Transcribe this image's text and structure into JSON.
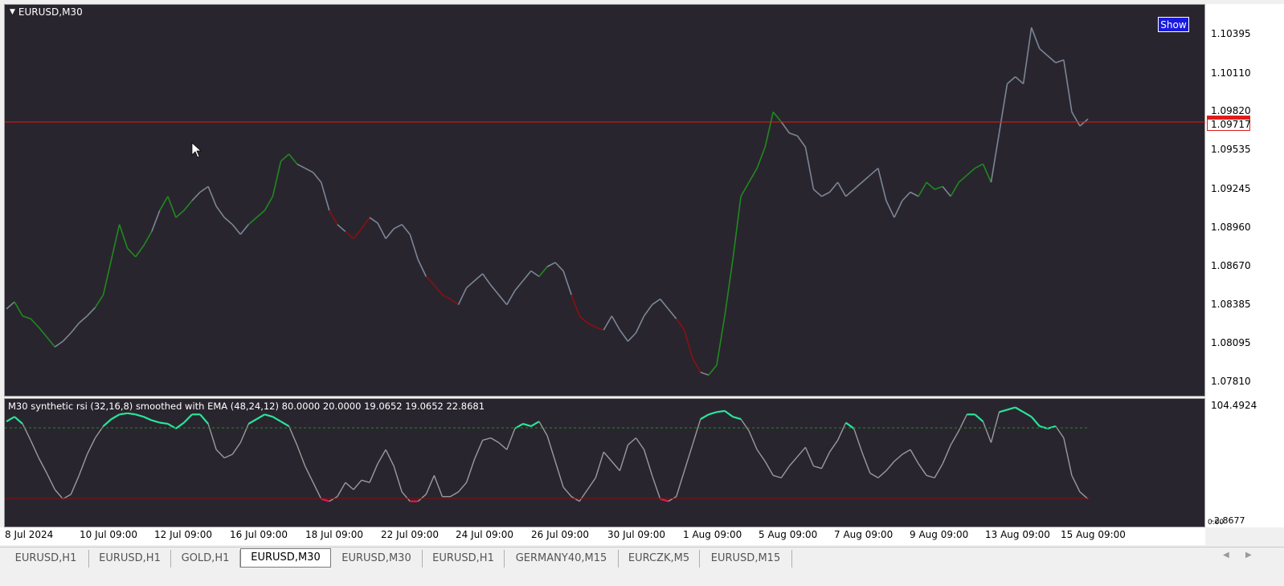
{
  "window": {
    "chart_title": "EURUSD,M30",
    "show_label": "Show"
  },
  "indicator": {
    "title": "M30 synthetic rsi (32,16,8) smoothed with EMA (48,24,12) 80.0000 20.0000 19.0652 19.0652 22.8681",
    "scale_top": "104.4924",
    "scale_bottom": "-2.8677",
    "scale_bottom_overlap": "0.00"
  },
  "price_scale": {
    "labels": [
      "1.10395",
      "1.10110",
      "1.09820",
      "1.09535",
      "1.09245",
      "1.08960",
      "1.08670",
      "1.08385",
      "1.08095",
      "1.07810"
    ],
    "current_price": "1.09717",
    "current_price_color": "#e01b1b"
  },
  "time_axis": {
    "labels": [
      "8 Jul 2024",
      "10 Jul 09:00",
      "12 Jul 09:00",
      "16 Jul 09:00",
      "18 Jul 09:00",
      "22 Jul 09:00",
      "24 Jul 09:00",
      "26 Jul 09:00",
      "30 Jul 09:00",
      "1 Aug 09:00",
      "5 Aug 09:00",
      "7 Aug 09:00",
      "9 Aug 09:00",
      "13 Aug 09:00",
      "15 Aug 09:00"
    ]
  },
  "tabs": [
    {
      "label": "EURUSD,H1",
      "active": false
    },
    {
      "label": "EURUSD,H1",
      "active": false
    },
    {
      "label": "GOLD,H1",
      "active": false
    },
    {
      "label": "EURUSD,M30",
      "active": true
    },
    {
      "label": "EURUSD,M30",
      "active": false
    },
    {
      "label": "EURUSD,H1",
      "active": false
    },
    {
      "label": "GERMANY40,M15",
      "active": false
    },
    {
      "label": "EURCZK,M5",
      "active": false
    },
    {
      "label": "EURUSD,M15",
      "active": false
    }
  ],
  "colors": {
    "background": "#29252e",
    "bull": "#1f8a1f",
    "bear": "#8b1010",
    "neutral": "#7a8696",
    "rsi_high": "#27e69a",
    "rsi_low": "#e0194a",
    "rsi_mid": "#9a9a9a",
    "level_high": "#1f8a1f",
    "level_low": "#8b1010"
  },
  "icons": {
    "collapse": "triangle-down-icon",
    "scroll_left": "triangle-left-icon",
    "scroll_right": "triangle-right-icon"
  },
  "chart_data": {
    "type": "line",
    "ylim": [
      1.0775,
      1.105
    ],
    "x_count": 135,
    "price_path": [
      1.0835,
      1.084,
      1.083,
      1.0828,
      1.0822,
      1.0815,
      1.0808,
      1.0812,
      1.0818,
      1.0825,
      1.083,
      1.0836,
      1.0845,
      1.087,
      1.0895,
      1.0878,
      1.0872,
      1.088,
      1.089,
      1.0905,
      1.0915,
      1.09,
      1.0905,
      1.0912,
      1.0918,
      1.0922,
      1.0908,
      1.09,
      1.0895,
      1.0888,
      1.0895,
      1.09,
      1.0905,
      1.0915,
      1.094,
      1.0945,
      1.0938,
      1.0935,
      1.0932,
      1.0925,
      1.0905,
      1.0895,
      1.089,
      1.0885,
      1.0892,
      1.09,
      1.0896,
      1.0885,
      1.0892,
      1.0895,
      1.0888,
      1.087,
      1.0858,
      1.0852,
      1.0845,
      1.0842,
      1.0838,
      1.085,
      1.0855,
      1.086,
      1.0852,
      1.0845,
      1.0838,
      1.0848,
      1.0855,
      1.0862,
      1.0858,
      1.0865,
      1.0868,
      1.0862,
      1.0845,
      1.083,
      1.0825,
      1.0822,
      1.082,
      1.083,
      1.082,
      1.0812,
      1.0818,
      1.083,
      1.0838,
      1.0842,
      1.0835,
      1.0828,
      1.082,
      1.08,
      1.079,
      1.0788,
      1.0795,
      1.083,
      1.087,
      1.0915,
      1.0925,
      1.0935,
      1.095,
      1.0975,
      1.0968,
      1.096,
      1.0958,
      1.095,
      1.092,
      1.0915,
      1.0918,
      1.0925,
      1.0915,
      1.092,
      1.0925,
      1.093,
      1.0935,
      1.0912,
      1.09,
      1.0912,
      1.0918,
      1.0915,
      1.0925,
      1.092,
      1.0922,
      1.0915,
      1.0925,
      1.093,
      1.0935,
      1.0938,
      1.0925,
      1.096,
      1.0995,
      1.1,
      1.0995,
      1.1035,
      1.102,
      1.1015,
      1.101,
      1.1012,
      1.0975,
      1.0965,
      1.097
    ],
    "price_states": "nbbbbbnnnnnbbbbbbbnbbbbnnnnnnnbbbbbbnnnnrnrrrnnnnnnnrrrrnnnnnnnnnnbnnnrrrrnnnnnnnnnrrrnbbbbbbbbbnnnnnnnnnnnnnnnnnbbbnbbbbbnnnnnnnnnn",
    "rsi_ylim": [
      -2.8677,
      104.4924
    ],
    "levels": [
      80,
      20
    ],
    "rsi_path": [
      86,
      90,
      84,
      70,
      55,
      42,
      28,
      20,
      24,
      40,
      58,
      72,
      82,
      88,
      92,
      93,
      92,
      90,
      87,
      85,
      84,
      80,
      85,
      92,
      92,
      84,
      62,
      55,
      58,
      68,
      84,
      88,
      92,
      90,
      86,
      82,
      66,
      48,
      34,
      20,
      18,
      22,
      34,
      28,
      36,
      34,
      50,
      62,
      48,
      26,
      18,
      18,
      24,
      40,
      22,
      22,
      26,
      34,
      54,
      70,
      72,
      68,
      62,
      80,
      84,
      82,
      86,
      74,
      52,
      30,
      22,
      18,
      28,
      38,
      60,
      52,
      44,
      66,
      72,
      62,
      40,
      20,
      18,
      22,
      44,
      66,
      88,
      92,
      94,
      95,
      90,
      88,
      78,
      62,
      52,
      40,
      38,
      48,
      56,
      64,
      48,
      46,
      60,
      70,
      85,
      80,
      60,
      42,
      38,
      44,
      52,
      58,
      62,
      50,
      40,
      38,
      50,
      66,
      78,
      92,
      92,
      86,
      68,
      94,
      96,
      98,
      94,
      90,
      82,
      80,
      82,
      72,
      40,
      26,
      20
    ]
  }
}
